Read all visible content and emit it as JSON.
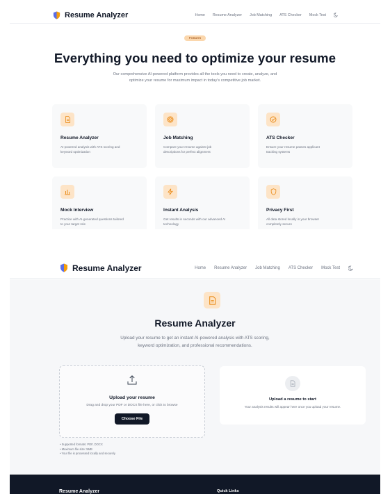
{
  "colors": {
    "accent": "#f59e0b",
    "accent_soft": "#fde4c7",
    "dark": "#111827",
    "muted": "#6b7280",
    "panel": "#f6f7f9"
  },
  "nav": {
    "brand": "Resume Analyzer",
    "brand_icon": "shield-icon",
    "links": [
      "Home",
      "Resume Analyzer",
      "Job Matching",
      "ATS Checker",
      "Mock Test"
    ],
    "theme_icon": "moon-icon"
  },
  "features_page": {
    "badge": "Features",
    "title": "Everything you need to optimize your resume",
    "subtitle_lines": [
      "Our comprehensive AI-powered platform provides all the tools you need to create, analyze, and",
      "optimize your resume for maximum impact in today's competitive job market."
    ],
    "cards": [
      {
        "icon": "document-icon",
        "title": "Resume Analyzer",
        "desc_lines": [
          "AI-powered analysis with ATS scoring and",
          "keyword optimization"
        ]
      },
      {
        "icon": "target-icon",
        "title": "Job Matching",
        "desc_lines": [
          "Compare your resume against job",
          "descriptions for perfect alignment"
        ]
      },
      {
        "icon": "check-circle-icon",
        "title": "ATS Checker",
        "desc_lines": [
          "Ensure your resume passes applicant",
          "tracking systems"
        ]
      },
      {
        "icon": "bar-chart-icon",
        "title": "Mock Interview",
        "desc_lines": [
          "Practice with AI-generated questions tailored",
          "to your target role"
        ]
      },
      {
        "icon": "bolt-icon",
        "title": "Instant Analysis",
        "desc_lines": [
          "Get results in seconds with our advanced AI",
          "technology"
        ]
      },
      {
        "icon": "shield-icon",
        "title": "Privacy First",
        "desc_lines": [
          "All data stored locally in your browser",
          "completely secure"
        ]
      }
    ]
  },
  "analyzer_page": {
    "page_icon": "document-icon",
    "title": "Resume Analyzer",
    "subtitle_lines": [
      "Upload your resume to get an instant AI-powered analysis with ATS scoring,",
      "keyword optimization, and professional recommendations."
    ],
    "upload": {
      "icon": "upload-icon",
      "title": "Upload your resume",
      "desc": "Drag and drop your PDF or DOCX file here, or click to browse",
      "button": "Choose File"
    },
    "notes": [
      "• Supported formats: PDF, DOCX",
      "• Maximum file size: 5MB",
      "• Your file is processed locally and securely"
    ],
    "result": {
      "icon": "document-icon",
      "title": "Upload a resume to start",
      "desc": "Your analysis results will appear here once you upload your resume."
    }
  },
  "footer": {
    "brand": "Resume Analyzer",
    "quick_links": "Quick Links"
  }
}
